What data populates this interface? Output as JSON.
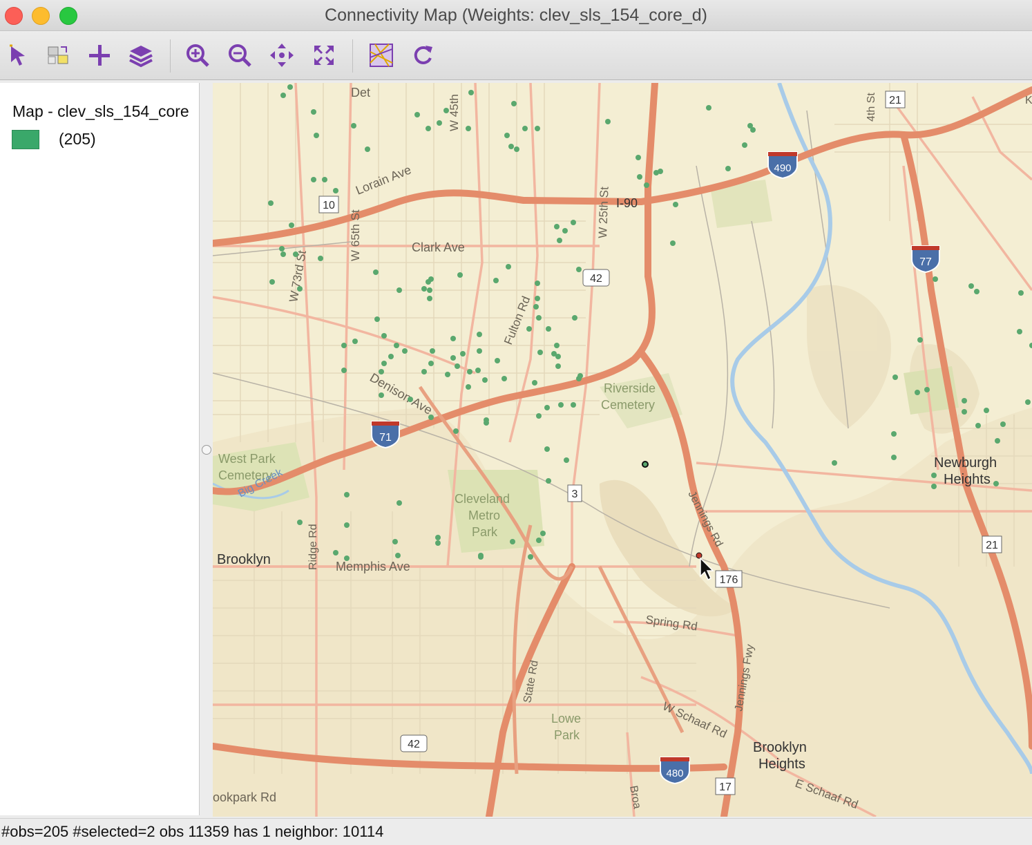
{
  "window": {
    "title": "Connectivity Map (Weights: clev_sls_154_core_d)"
  },
  "toolbar": {
    "tools": [
      {
        "name": "select-tool",
        "icon": "pointer-icon"
      },
      {
        "name": "selection-mode",
        "icon": "select-shapes-icon"
      },
      {
        "name": "add-layer",
        "icon": "plus-icon"
      },
      {
        "name": "layers",
        "icon": "layers-icon"
      },
      {
        "name": "zoom-in",
        "icon": "zoom-in-icon"
      },
      {
        "name": "zoom-out",
        "icon": "zoom-out-icon"
      },
      {
        "name": "pan",
        "icon": "pan-icon"
      },
      {
        "name": "full-extent",
        "icon": "full-extent-icon"
      },
      {
        "name": "basemap",
        "icon": "basemap-icon"
      },
      {
        "name": "refresh",
        "icon": "refresh-icon"
      }
    ],
    "accent": "#7b3fb0"
  },
  "legend": {
    "title": "Map - clev_sls_154_core",
    "swatch_color": "#3aa86a",
    "count": "(205)"
  },
  "map": {
    "labels": {
      "detroit": "Det",
      "w45": "W 45th",
      "lorain": "Lorain Ave",
      "w65": "W 65th St",
      "w73": "W 73rd St",
      "clark": "Clark Ave",
      "w25": "W 25th St",
      "i90": "I-90",
      "fulton": "Fulton Rd",
      "denison": "Denison Ave",
      "riverside": "Riverside",
      "cemetery": "Cemetery",
      "westpark1": "West Park",
      "westpark2": "Cemetery",
      "bigcreek": "Big Creek",
      "clevmetro1": "Cleveland",
      "clevmetro2": "Metro",
      "clevmetro3": "Park",
      "brooklyn": "Brooklyn",
      "ridge": "Ridge Rd",
      "memphis": "Memphis Ave",
      "jennings": "Jennings Rd",
      "spring": "Spring Rd",
      "state": "State Rd",
      "jenningsfwy": "Jennings Fwy",
      "lowe1": "Lowe",
      "lowe2": "Park",
      "schaaf": "W Schaaf Rd",
      "brooklynh1": "Brooklyn",
      "brooklynh2": "Heights",
      "eschaaf": "E Schaaf Rd",
      "newburgh1": "Newburgh",
      "newburgh2": "Heights",
      "brookpark": "ookpark Rd",
      "broad": "Broa",
      "e4th": "4th St",
      "k": "K"
    },
    "shields": {
      "i490": "490",
      "i77": "77",
      "i71": "71",
      "i480": "480",
      "us42a": "42",
      "us42b": "42",
      "r10": "10",
      "r21a": "21",
      "r21b": "21",
      "r3": "3",
      "r176": "176",
      "r17": "17"
    },
    "point_color": "#5aa86e",
    "selected_point_color": "#1a1a1a",
    "neighbor_point_color": "#c0392b"
  },
  "status": {
    "text": "#obs=205 #selected=2  obs 11359 has 1 neighbor: 10114"
  }
}
